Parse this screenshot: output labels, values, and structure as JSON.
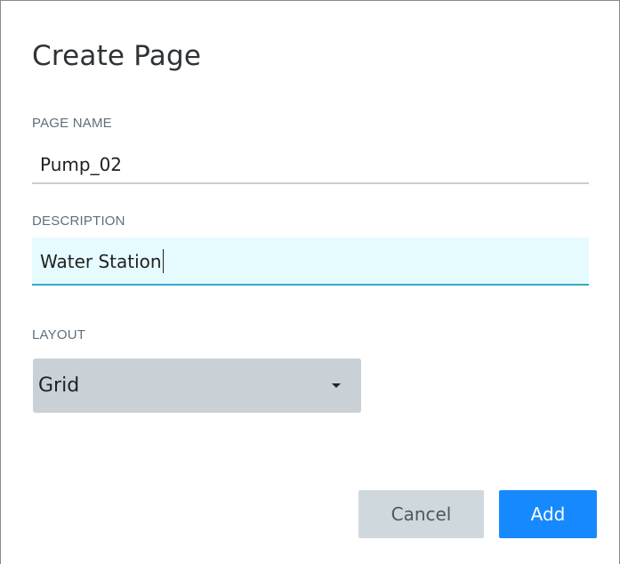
{
  "dialog": {
    "title": "Create Page"
  },
  "fields": {
    "page_name": {
      "label": "PAGE NAME",
      "value": "Pump_02"
    },
    "description": {
      "label": "DESCRIPTION",
      "value": "Water Station"
    },
    "layout": {
      "label": "LAYOUT",
      "selected": "Grid"
    }
  },
  "actions": {
    "cancel_label": "Cancel",
    "add_label": "Add"
  },
  "colors": {
    "primary": "#1689ff",
    "description_focus_background": "#e6fbff",
    "description_focus_border": "#3aa6c8",
    "select_background": "#c9d1d6",
    "cancel_background": "#cfd8dd"
  },
  "icons": {
    "layout_dropdown": "chevron-down-icon"
  }
}
